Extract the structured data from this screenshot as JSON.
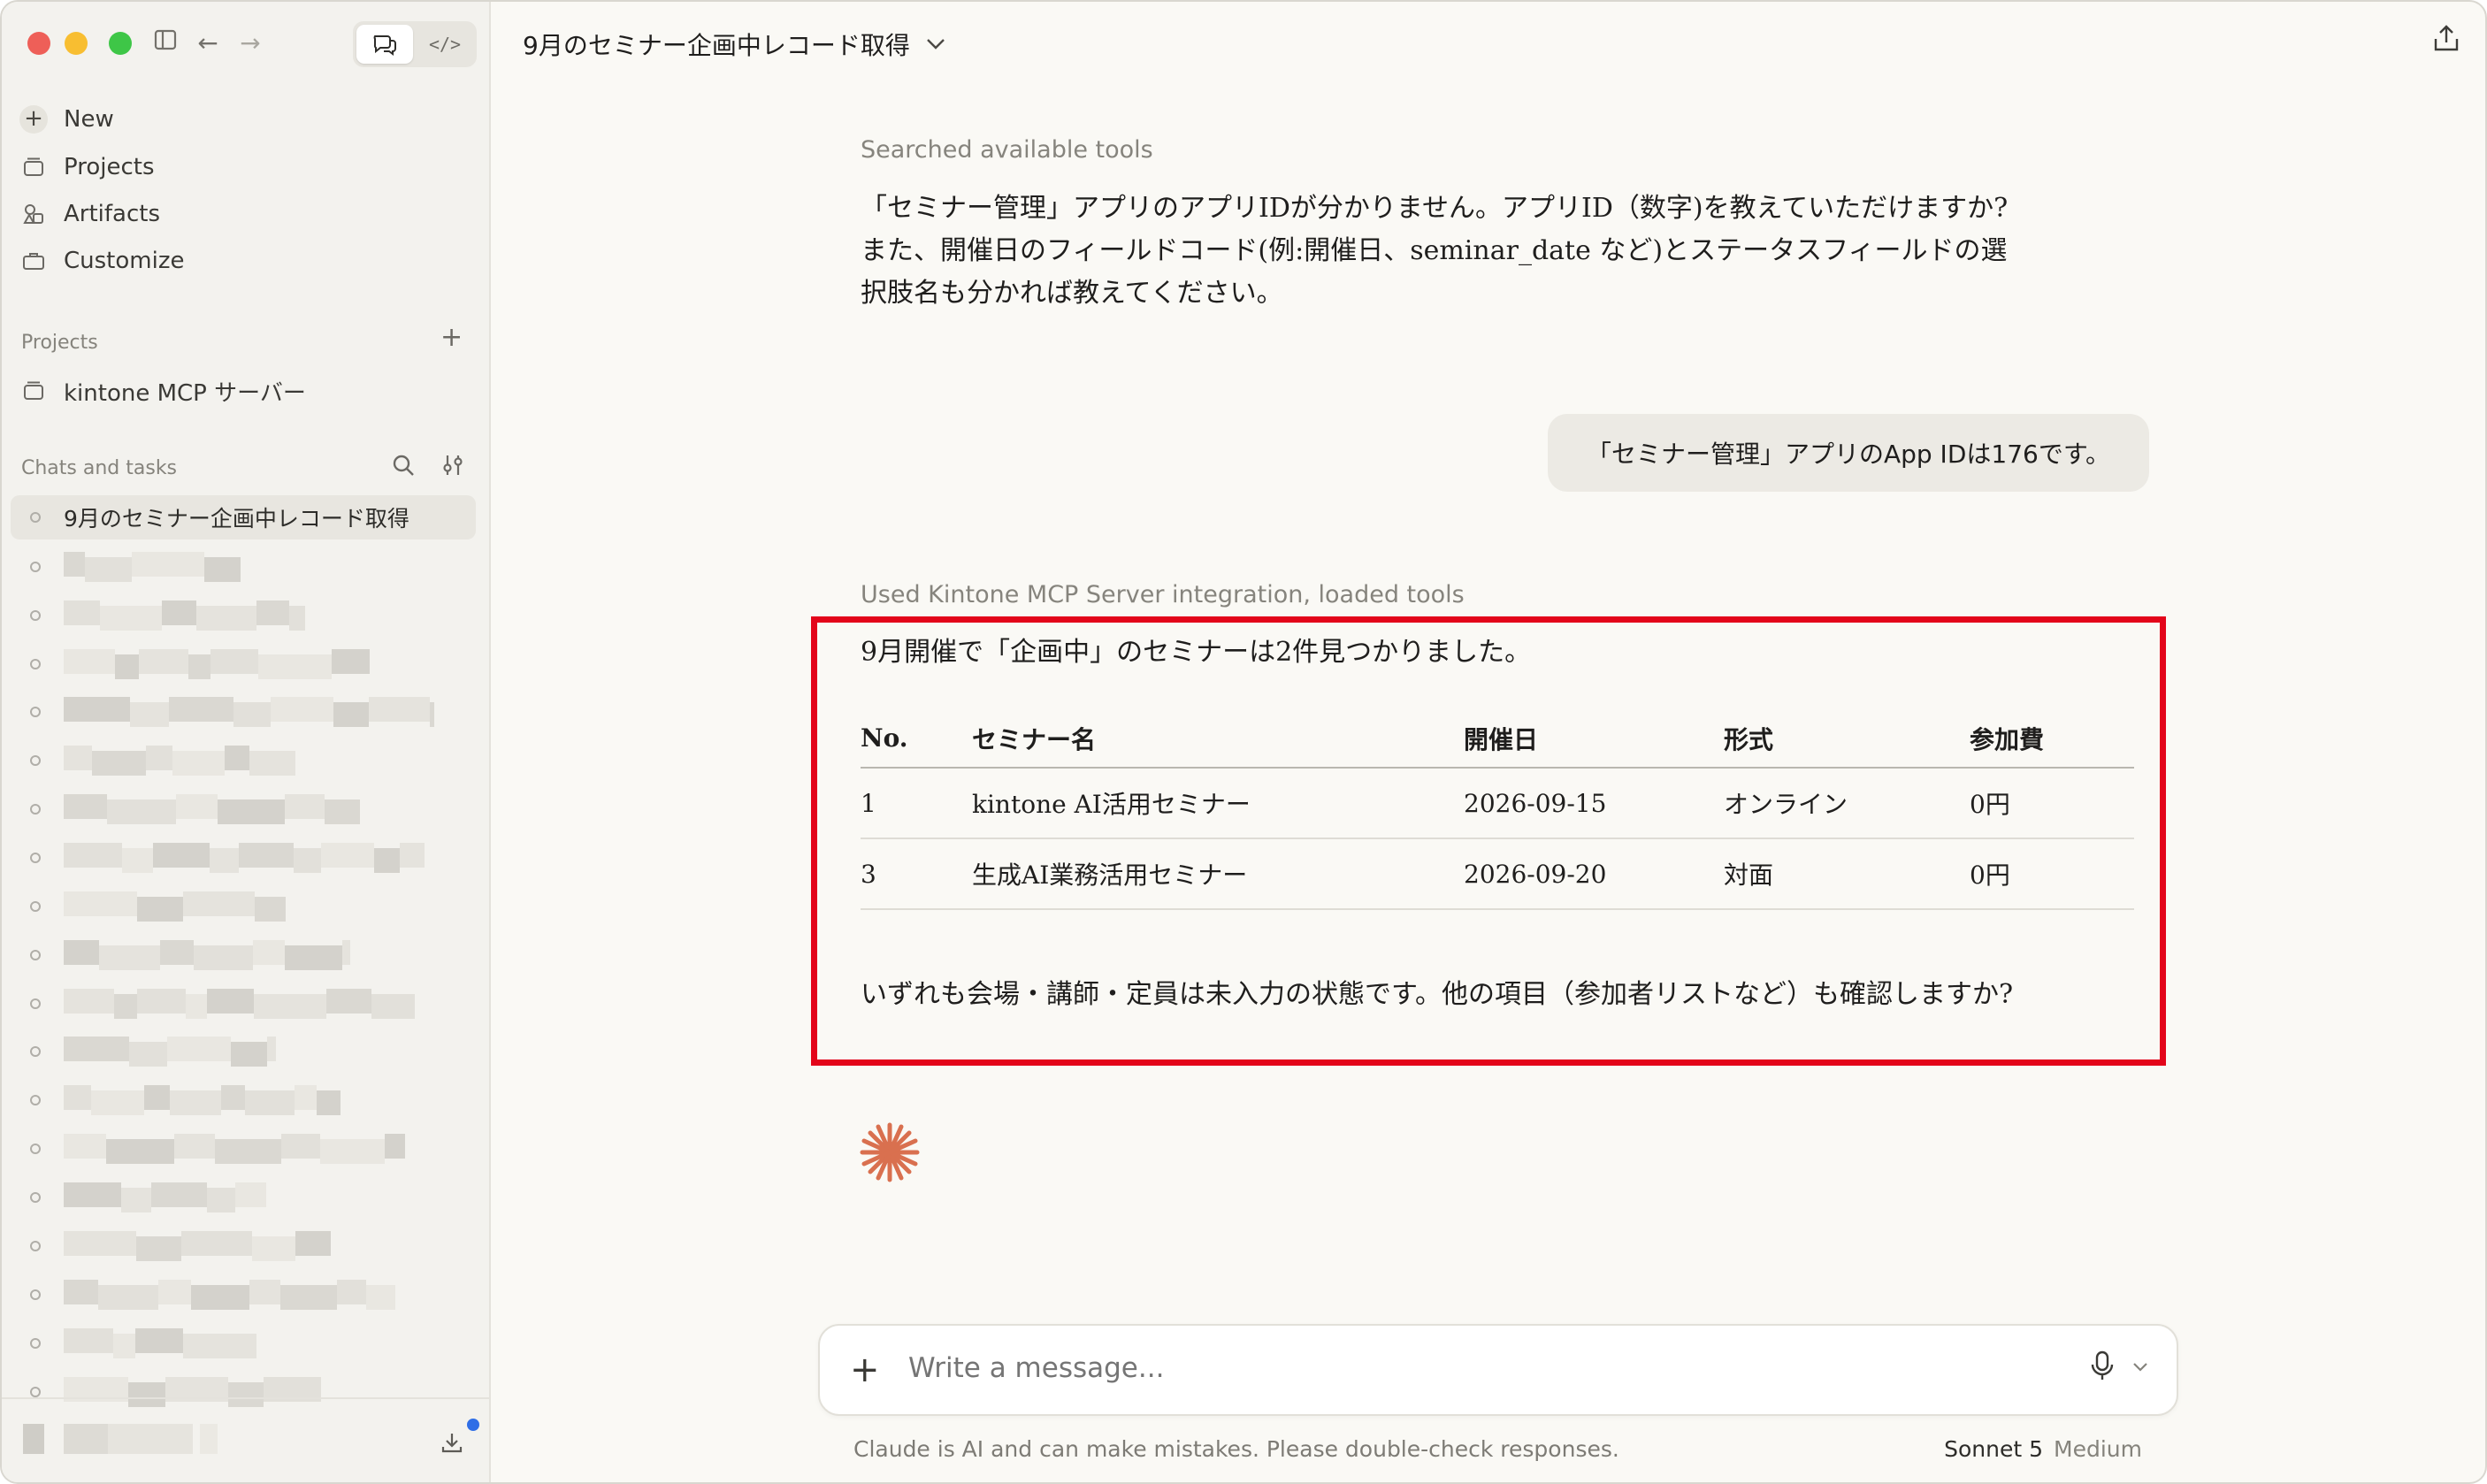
{
  "window": {
    "toolbar": {
      "sidebar_toggle_icon": "sidebar-icon",
      "back_icon": "arrow-left-icon",
      "forward_icon": "arrow-right-icon",
      "mode_chat_icon": "chat-bubbles-icon",
      "mode_code_icon": "code-icon"
    }
  },
  "sidebar": {
    "nav": [
      {
        "label": "New",
        "icon": "plus-icon"
      },
      {
        "label": "Projects",
        "icon": "folder-icon"
      },
      {
        "label": "Artifacts",
        "icon": "artifacts-icon"
      },
      {
        "label": "Customize",
        "icon": "briefcase-icon"
      }
    ],
    "projects_heading": "Projects",
    "projects": [
      {
        "label": "kintone MCP サーバー",
        "icon": "folder-icon"
      }
    ],
    "chats_heading": "Chats and tasks",
    "active_chat": "9月のセミナー企画中レコード取得"
  },
  "header": {
    "title": "9月のセミナー企画中レコード取得"
  },
  "conversation": {
    "tool_label_1": "Searched available tools",
    "assistant_msg_1": [
      "「セミナー管理」アプリのアプリIDが分かりません。アプリID（数字)を教えていただけますか?",
      "また、開催日のフィールドコード(例:開催日、seminar_date など)とステータスフィールドの選",
      "択肢名も分かれば教えてください。"
    ],
    "user_msg": "「セミナー管理」アプリのApp IDは176です。",
    "tool_label_2": "Used Kintone MCP Server integration, loaded tools",
    "assistant_msg_2_intro": "9月開催で「企画中」のセミナーは2件見つかりました。",
    "table": {
      "headers": [
        "No.",
        "セミナー名",
        "開催日",
        "形式",
        "参加費"
      ],
      "rows": [
        [
          "1",
          "kintone AI活用セミナー",
          "2026-09-15",
          "オンライン",
          "0円"
        ],
        [
          "3",
          "生成AI業務活用セミナー",
          "2026-09-20",
          "対面",
          "0円"
        ]
      ]
    },
    "assistant_msg_2_outro": "いずれも会場・講師・定員は未入力の状態です。他の項目（参加者リストなど）も確認しますか?"
  },
  "composer": {
    "placeholder": "Write a message...",
    "add_icon": "plus-icon",
    "mic_icon": "microphone-icon"
  },
  "footer": {
    "disclaimer": "Claude is AI and can make mistakes. Please double-check responses.",
    "model": "Sonnet 5",
    "effort": "Medium"
  },
  "colors": {
    "highlight_border": "#e3051a",
    "spark": "#d9704f",
    "badge": "#2f6ee6"
  }
}
